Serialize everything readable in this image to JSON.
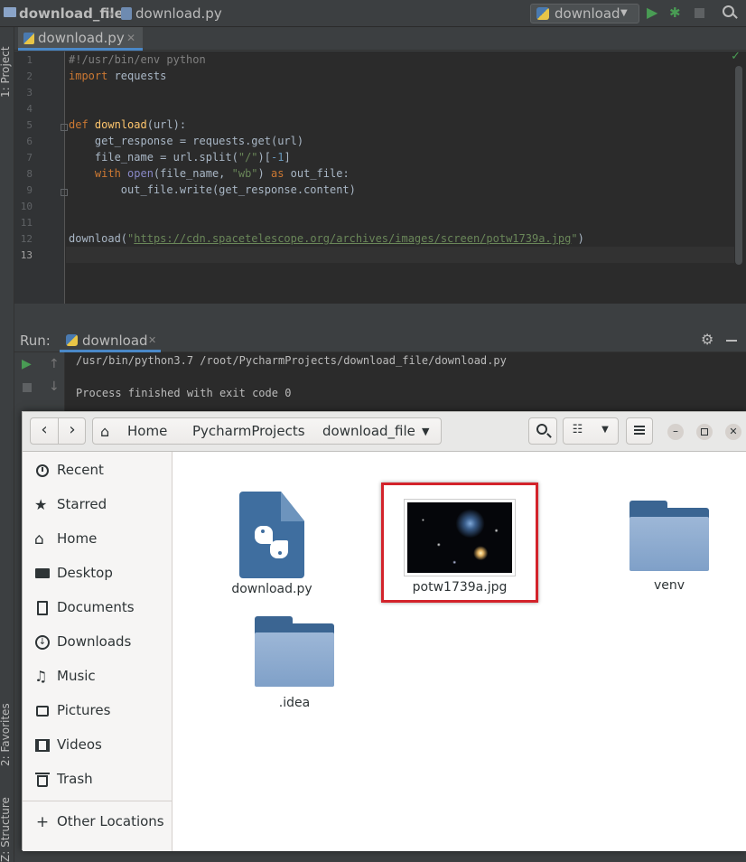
{
  "navbar": {
    "project": "download_file",
    "file": "download.py",
    "run_config": "download"
  },
  "left_strip": {
    "project": "1: Project",
    "favorites": "2: Favorites",
    "structure": "Z: Structure"
  },
  "editor": {
    "tab_label": "download.py",
    "line_numbers": [
      "1",
      "2",
      "3",
      "4",
      "5",
      "6",
      "7",
      "8",
      "9",
      "10",
      "11",
      "12",
      "13"
    ],
    "code": {
      "l1": "#!/usr/bin/env python",
      "l2_kw": "import",
      "l2_rest": " requests",
      "l5_kw": "def",
      "l5_fn": "download",
      "l5_rest": "(url):",
      "l6": "    get_response = requests.get(url)",
      "l7_a": "    file_name = url.split(",
      "l7_str": "\"/\"",
      "l7_b": ")[",
      "l7_num": "-1",
      "l7_c": "]",
      "l8_kw": "    with",
      "l8_bi": " open",
      "l8_a": "(file_name, ",
      "l8_str": "\"wb\"",
      "l8_b": ") ",
      "l8_kw2": "as",
      "l8_c": " out_file:",
      "l9": "        out_file.write(get_response.content)",
      "l12_a": "download(",
      "l12_q1": "\"",
      "l12_url": "https://cdn.spacetelescope.org/archives/images/screen/potw1739a.jpg",
      "l12_q2": "\"",
      "l12_b": ")"
    }
  },
  "run": {
    "label": "Run:",
    "tab": "download",
    "output_line1": "/usr/bin/python3.7 /root/PycharmProjects/download_file/download.py",
    "output_line2": "Process finished with exit code 0"
  },
  "file_manager": {
    "breadcrumbs": [
      "Home",
      "PycharmProjects",
      "download_file"
    ],
    "sidebar": [
      {
        "label": "Recent",
        "icon": "clock-icon"
      },
      {
        "label": "Starred",
        "icon": "star-icon"
      },
      {
        "label": "Home",
        "icon": "home-icon"
      },
      {
        "label": "Desktop",
        "icon": "desktop-icon"
      },
      {
        "label": "Documents",
        "icon": "document-icon"
      },
      {
        "label": "Downloads",
        "icon": "download-icon"
      },
      {
        "label": "Music",
        "icon": "music-icon"
      },
      {
        "label": "Pictures",
        "icon": "pictures-icon"
      },
      {
        "label": "Videos",
        "icon": "video-icon"
      },
      {
        "label": "Trash",
        "icon": "trash-icon"
      },
      {
        "label": "Other Locations",
        "icon": "plus-icon"
      }
    ],
    "files": [
      {
        "name": "download.py",
        "type": "python-file"
      },
      {
        "name": "potw1739a.jpg",
        "type": "image"
      },
      {
        "name": "venv",
        "type": "folder"
      },
      {
        "name": ".idea",
        "type": "folder"
      }
    ]
  },
  "colors": {
    "ide_bg": "#2b2b2b",
    "panel_bg": "#3c3f41",
    "keyword": "#cc7832",
    "string": "#6a8759",
    "function": "#ffc66d",
    "highlight_box": "#d3232b",
    "folder": "#5a88b8"
  }
}
